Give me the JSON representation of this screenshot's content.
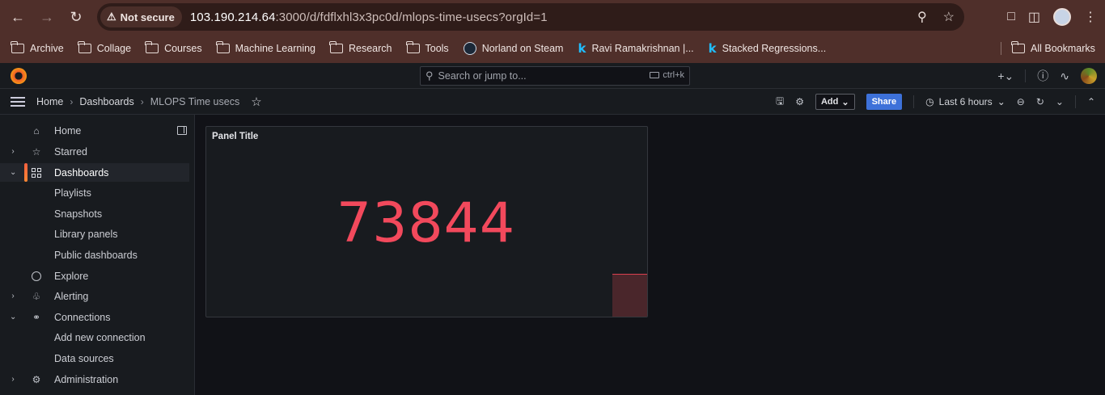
{
  "browser": {
    "security_label": "Not secure",
    "url_host": "103.190.214.64",
    "url_rest": ":3000/d/fdflxhl3x3pc0d/mlops-time-usecs?orgId=1",
    "bookmarks": [
      {
        "label": "Archive",
        "icon": "folder-icon"
      },
      {
        "label": "Collage",
        "icon": "folder-icon"
      },
      {
        "label": "Courses",
        "icon": "folder-icon"
      },
      {
        "label": "Machine Learning",
        "icon": "folder-icon"
      },
      {
        "label": "Research",
        "icon": "folder-icon"
      },
      {
        "label": "Tools",
        "icon": "folder-icon"
      },
      {
        "label": "Norland on Steam",
        "icon": "steam-icon"
      },
      {
        "label": "Ravi Ramakrishnan |...",
        "icon": "kaggle-icon"
      },
      {
        "label": "Stacked Regressions...",
        "icon": "kaggle-icon"
      }
    ],
    "all_bookmarks": "All Bookmarks"
  },
  "grafana": {
    "search_placeholder": "Search or jump to...",
    "search_shortcut": "ctrl+k",
    "breadcrumbs": {
      "home": "Home",
      "dashboards": "Dashboards",
      "current": "MLOPS Time usecs"
    },
    "toolbar": {
      "add_label": "Add",
      "share_label": "Share",
      "time_range": "Last 6 hours"
    },
    "sidebar": {
      "items": [
        {
          "label": "Home",
          "icon": "home-icon",
          "expandable": false
        },
        {
          "label": "Starred",
          "icon": "star-icon",
          "expandable": true
        },
        {
          "label": "Dashboards",
          "icon": "apps-icon",
          "expandable": true,
          "active": true
        },
        {
          "label": "Playlists"
        },
        {
          "label": "Snapshots"
        },
        {
          "label": "Library panels"
        },
        {
          "label": "Public dashboards"
        },
        {
          "label": "Explore",
          "icon": "compass-icon",
          "expandable": false
        },
        {
          "label": "Alerting",
          "icon": "bell-icon",
          "expandable": true
        },
        {
          "label": "Connections",
          "icon": "link-icon",
          "expandable": true
        },
        {
          "label": "Add new connection"
        },
        {
          "label": "Data sources"
        },
        {
          "label": "Administration",
          "icon": "cog-icon",
          "expandable": true
        }
      ]
    },
    "panel": {
      "title": "Panel Title",
      "value": "73844",
      "value_color": "#f2495c"
    }
  },
  "colors": {
    "chrome": "#4f2f2a",
    "grafana_bg": "#111217",
    "accent_orange": "#f55f3e",
    "share_blue": "#3d71d9"
  }
}
